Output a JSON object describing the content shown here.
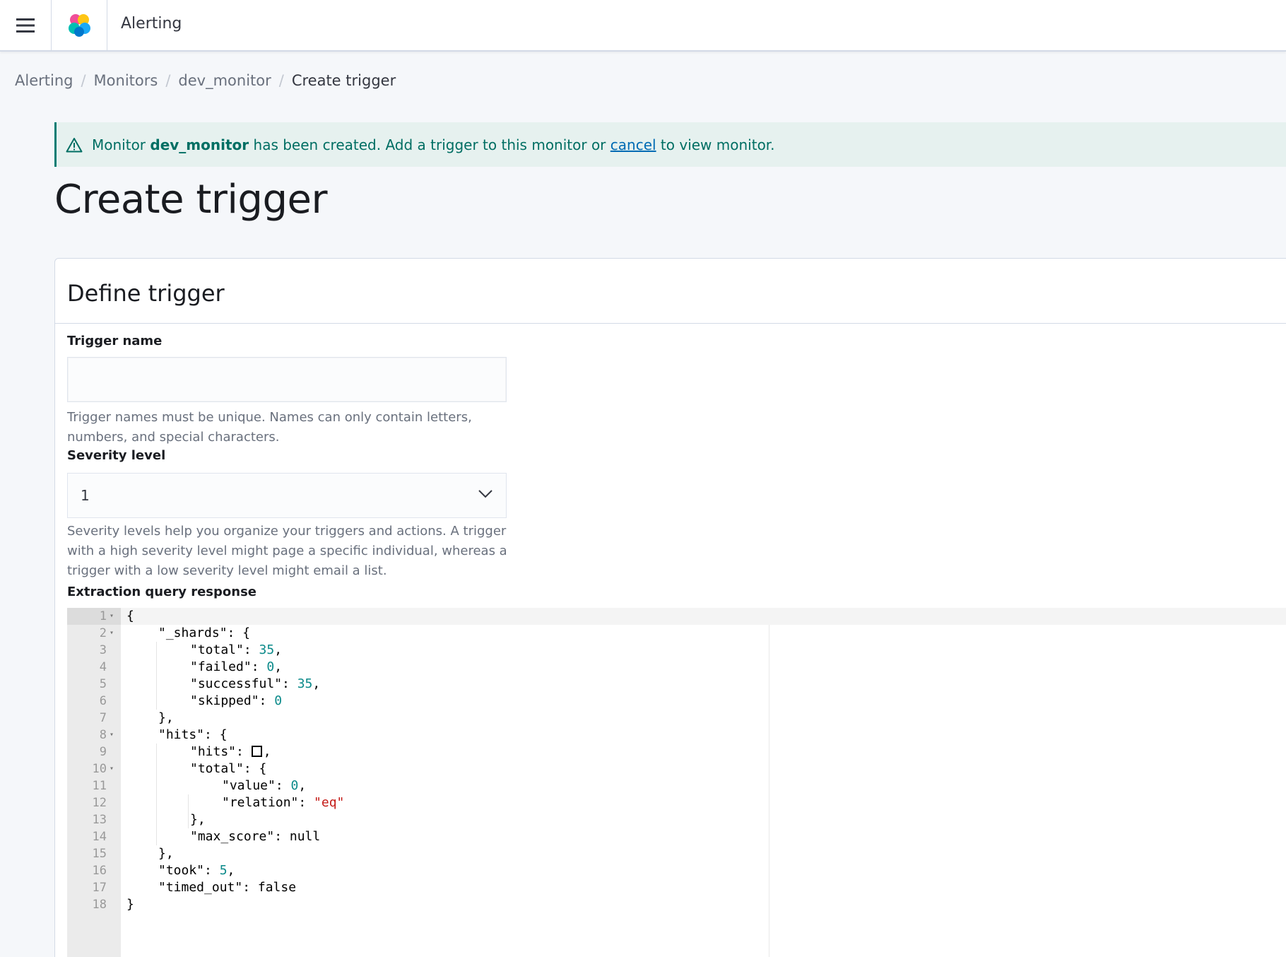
{
  "header": {
    "app_title": "Alerting",
    "menu_icon": "hamburger-menu-icon",
    "logo_icon": "opensearch-dashboards-logo"
  },
  "breadcrumb": [
    {
      "label": "Alerting"
    },
    {
      "label": "Monitors"
    },
    {
      "label": "dev_monitor"
    },
    {
      "label": "Create trigger"
    }
  ],
  "breadcrumb_separator": "/",
  "callout": {
    "prefix": "Monitor",
    "monitor_name": "dev_monitor",
    "middle": "has been created. Add a trigger to this monitor or",
    "link": "cancel",
    "suffix": "to view monitor.",
    "icon": "warning-icon"
  },
  "page_title": "Create trigger",
  "panel": {
    "title": "Define trigger",
    "trigger_name": {
      "label": "Trigger name",
      "value": "",
      "help": "Trigger names must be unique. Names can only contain letters, numbers, and special characters."
    },
    "severity": {
      "label": "Severity level",
      "value": "1",
      "help": "Severity levels help you organize your triggers and actions. A trigger with a high severity level might page a specific individual, whereas a trigger with a low severity level might email a list."
    },
    "extraction": {
      "label": "Extraction query response"
    }
  },
  "code_lines": [
    "{",
    "\"_shards\": {",
    "\"total\": 35,",
    "\"failed\": 0,",
    "\"successful\": 35,",
    "\"skipped\": 0",
    "},",
    "\"hits\": {",
    "\"hits\": [],",
    "\"total\": {",
    "\"value\": 0,",
    "\"relation\": \"eq\"",
    "},",
    "\"max_score\": null",
    "},",
    "\"took\": 5,",
    "\"timed_out\": false",
    "}"
  ],
  "colors": {
    "accent": "#017d73",
    "link": "#006bb4",
    "number": "#0b8a8a",
    "string": "#c41a16"
  }
}
